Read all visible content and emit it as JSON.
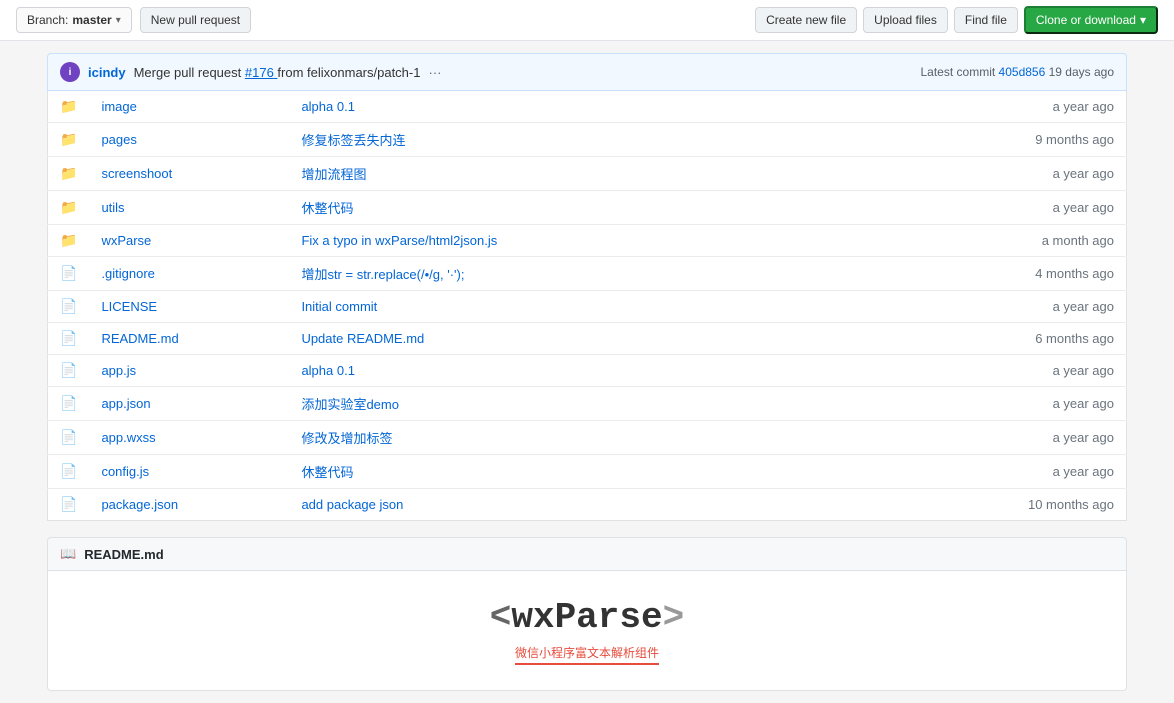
{
  "toolbar": {
    "branch_label": "Branch:",
    "branch_name": "master",
    "new_pr_label": "New pull request",
    "create_file_label": "Create new file",
    "upload_files_label": "Upload files",
    "find_file_label": "Find file",
    "clone_label": "Clone or download"
  },
  "commit_bar": {
    "author": "icindy",
    "message": "Merge pull request",
    "pr_number": "#176",
    "pr_from": "from felixonmars/patch-1",
    "dots": "···",
    "latest_label": "Latest commit",
    "commit_hash": "405d856",
    "time_ago": "19 days ago"
  },
  "files": [
    {
      "type": "folder",
      "name": "image",
      "commit": "alpha 0.1",
      "time": "a year ago"
    },
    {
      "type": "folder",
      "name": "pages",
      "commit": "修复标签丢失内连",
      "time": "9 months ago"
    },
    {
      "type": "folder",
      "name": "screenshoot",
      "commit": "增加流程图",
      "time": "a year ago"
    },
    {
      "type": "folder",
      "name": "utils",
      "commit": "休整代码",
      "time": "a year ago"
    },
    {
      "type": "folder",
      "name": "wxParse",
      "commit": "Fix a typo in wxParse/html2json.js",
      "time": "a month ago"
    },
    {
      "type": "file",
      "name": ".gitignore",
      "commit": "增加str = str.replace(/&#8226;/g, '·');",
      "time": "4 months ago"
    },
    {
      "type": "file",
      "name": "LICENSE",
      "commit": "Initial commit",
      "time": "a year ago"
    },
    {
      "type": "file",
      "name": "README.md",
      "commit": "Update README.md",
      "time": "6 months ago"
    },
    {
      "type": "file",
      "name": "app.js",
      "commit": "alpha 0.1",
      "time": "a year ago"
    },
    {
      "type": "file",
      "name": "app.json",
      "commit": "添加实验室demo",
      "time": "a year ago"
    },
    {
      "type": "file",
      "name": "app.wxss",
      "commit": "修改及增加标签",
      "time": "a year ago"
    },
    {
      "type": "file",
      "name": "config.js",
      "commit": "休整代码",
      "time": "a year ago"
    },
    {
      "type": "file",
      "name": "package.json",
      "commit": "add package json",
      "time": "10 months ago"
    }
  ],
  "readme": {
    "title": "README.md",
    "logo": "<wxParse>",
    "subtitle": "微信小程序富文本解析组件"
  }
}
